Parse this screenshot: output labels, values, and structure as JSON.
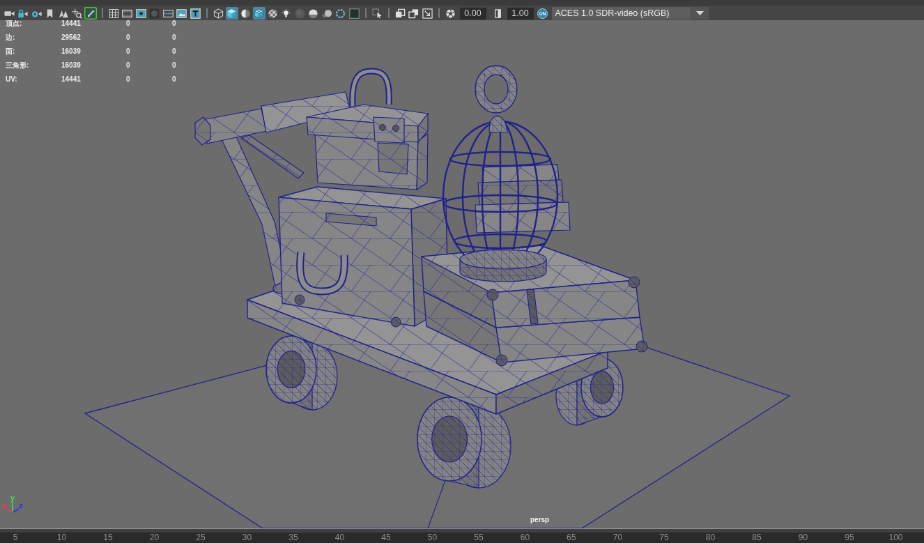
{
  "toolbar": {
    "camera_tools": [
      {
        "selected": false
      },
      {
        "selected": false
      },
      {
        "selected": false
      },
      {
        "selected": false
      },
      {
        "selected": false
      },
      {
        "selected": false
      },
      {
        "selected": true
      }
    ],
    "display_gates": [
      {
        "selected": false
      },
      {
        "selected": false
      },
      {
        "selected": false
      },
      {
        "selected": false
      },
      {
        "selected": false
      },
      {
        "selected": false
      },
      {
        "selected": false
      }
    ],
    "shading": [
      {
        "selected": false
      },
      {
        "selected": true
      },
      {
        "selected": false
      },
      {
        "selected": true
      },
      {
        "selected": false
      },
      {
        "selected": false
      },
      {
        "selected": false
      },
      {
        "selected": false
      },
      {
        "selected": false
      },
      {
        "selected": false
      },
      {
        "selected": false
      }
    ],
    "isolate_select": [
      {
        "selected": false
      }
    ],
    "xray": [
      {
        "selected": false
      },
      {
        "selected": false
      },
      {
        "selected": false
      }
    ],
    "exposure": {
      "value": "0.00"
    },
    "gamma": {
      "value": "1.00"
    },
    "view_transform": {
      "toggle_label": "ON",
      "on": true,
      "value": "ACES 1.0 SDR-video (sRGB)"
    }
  },
  "viewport": {
    "hud_stats": [
      {
        "label": "顶点:",
        "values": [
          "14441",
          "0",
          "0"
        ]
      },
      {
        "label": "边:",
        "values": [
          "29562",
          "0",
          "0"
        ]
      },
      {
        "label": "面:",
        "values": [
          "16039",
          "0",
          "0"
        ]
      },
      {
        "label": "三角形:",
        "values": [
          "16039",
          "0",
          "0"
        ]
      },
      {
        "label": "UV:",
        "values": [
          "14441",
          "0",
          "0"
        ]
      }
    ],
    "camera_label": "persp",
    "axes": [
      {
        "label": "x",
        "color": "#ff3a3a"
      },
      {
        "label": "y",
        "color": "#4ddc4d"
      },
      {
        "label": "z",
        "color": "#2828ff"
      }
    ]
  },
  "timeline": {
    "ticks": [
      "5",
      "10",
      "15",
      "20",
      "25",
      "30",
      "35",
      "40",
      "45",
      "50",
      "55",
      "60",
      "65",
      "70",
      "75",
      "80",
      "85",
      "90",
      "95",
      "100"
    ]
  }
}
